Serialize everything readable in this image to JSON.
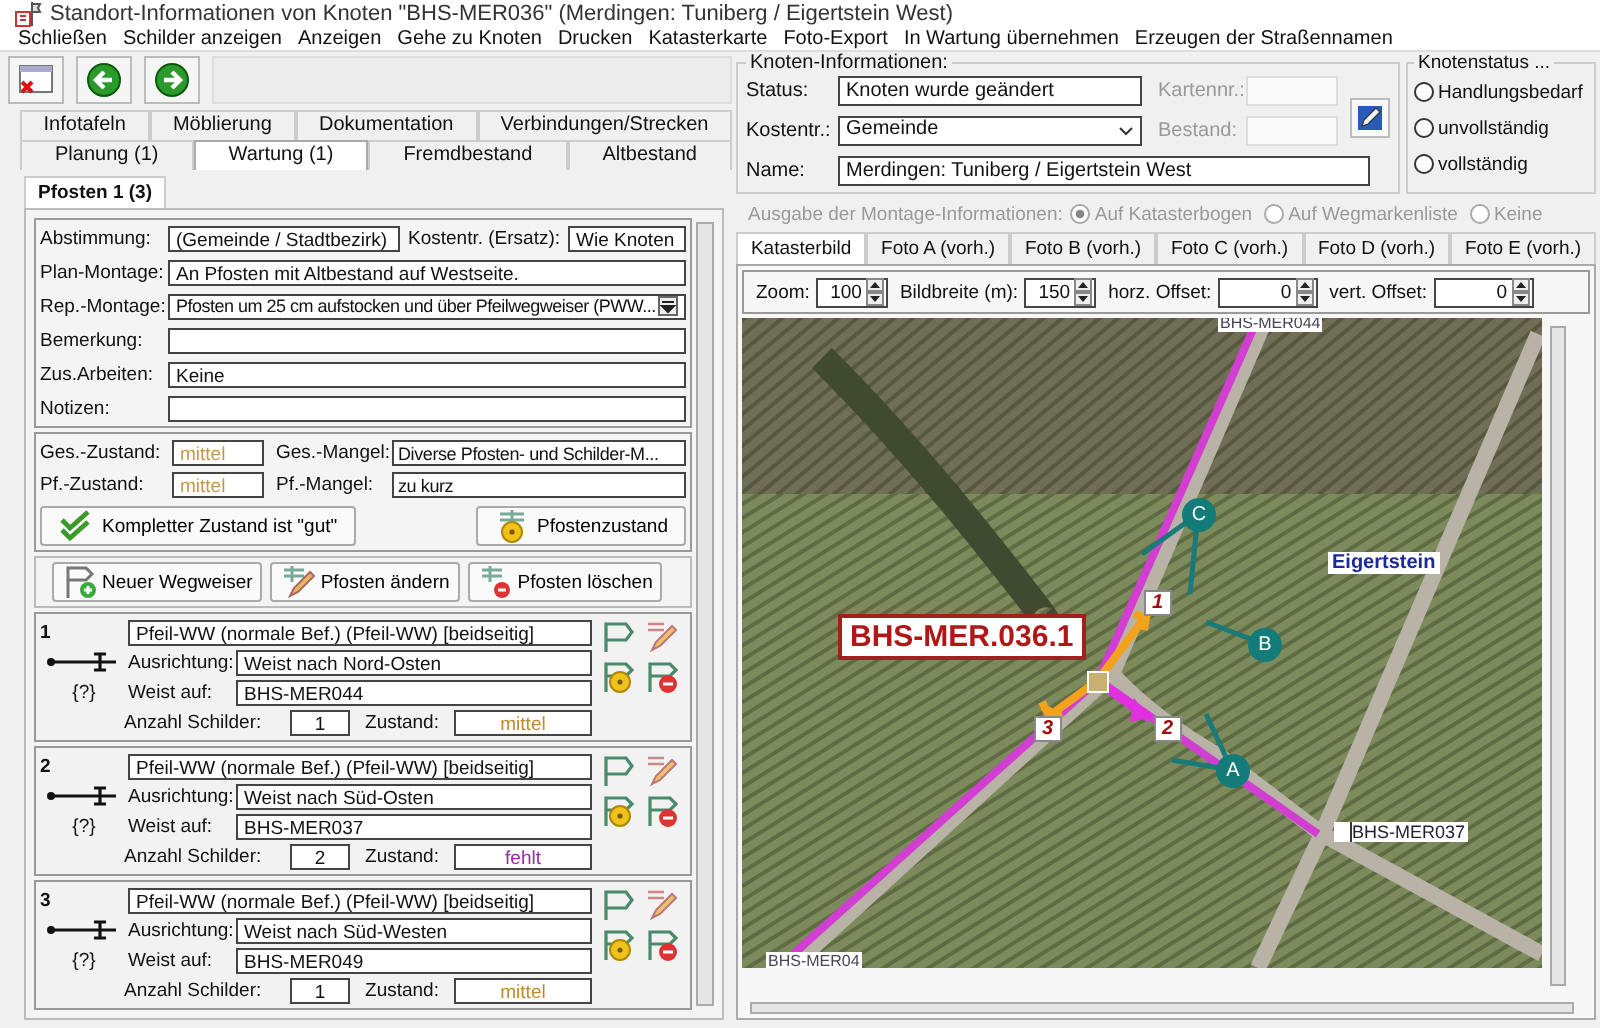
{
  "window": {
    "title": "Standort-Informationen von Knoten \"BHS-MER036\" (Merdingen: Tuniberg / Eigertstein West)"
  },
  "menu": [
    "Schließen",
    "Schilder anzeigen",
    "Anzeigen",
    "Gehe zu Knoten",
    "Drucken",
    "Katasterkarte",
    "Foto-Export",
    "In Wartung übernehmen",
    "Erzeugen der Straßennamen"
  ],
  "tab_rows": [
    [
      {
        "label": "Infotafeln",
        "selected": false
      },
      {
        "label": "Möblierung",
        "selected": false
      },
      {
        "label": "Dokumentation",
        "selected": false
      },
      {
        "label": "Verbindungen/Strecken",
        "selected": false
      }
    ],
    [
      {
        "label": "Planung (1)",
        "selected": false
      },
      {
        "label": "Wartung (1)",
        "selected": true
      },
      {
        "label": "Fremdbestand",
        "selected": false
      },
      {
        "label": "Altbestand",
        "selected": false
      }
    ]
  ],
  "subtabs": [
    {
      "label": "Pfosten 1 (3)",
      "selected": true
    }
  ],
  "post_fields": [
    {
      "kind": "pair",
      "label": "Abstimmung:",
      "value": "(Gemeinde / Stadtbezirk)",
      "label_2": "Kostentr. (Ersatz):",
      "value_2": "Wie Knoten"
    },
    {
      "kind": "text",
      "label": "Plan-Montage:",
      "value": "An Pfosten mit Altbestand auf Westseite."
    },
    {
      "kind": "dropdown",
      "label": "Rep.-Montage:",
      "value": "Pfosten um 25 cm aufstocken und über Pfeilwegweiser (PWW..."
    },
    {
      "kind": "text",
      "label": "Bemerkung:"
    },
    {
      "kind": "text",
      "label": "Zus.Arbeiten:",
      "value": "Keine"
    },
    {
      "kind": "text",
      "label": "Notizen:"
    }
  ],
  "condition_rows": [
    {
      "zustand_label": "Ges.-Zustand:",
      "zustand": "mittel",
      "color": "#c8964a",
      "mangel_label": "Ges.-Mangel:",
      "mangel": "Diverse Pfosten- und Schilder-M..."
    },
    {
      "zustand_label": "Pf.-Zustand:",
      "zustand": "mittel",
      "color": "#c8964a",
      "mangel_label": "Pf.-Mangel:",
      "mangel": "zu kurz"
    }
  ],
  "condition_buttons": [
    "Kompletter Zustand ist \"gut\"",
    "Pfostenzustand"
  ],
  "sign_actions": [
    "Neuer Wegweiser",
    "Pfosten ändern",
    "Pfosten löschen"
  ],
  "signs": [
    {
      "number": "1",
      "type": "Pfeil-WW (normale Bef.) (Pfeil-WW) [beidseitig]",
      "marker": "{?}",
      "ausrichtung_label": "Ausrichtung:",
      "ausrichtung": "Weist nach Nord-Osten",
      "weist_label": "Weist auf:",
      "weist": "BHS-MER044",
      "anzahl_label": "Anzahl Schilder:",
      "anzahl": "1",
      "zustand_label": "Zustand:",
      "zustand": "mittel",
      "color": "#c08a2c"
    },
    {
      "number": "2",
      "type": "Pfeil-WW (normale Bef.) (Pfeil-WW) [beidseitig]",
      "marker": "{?}",
      "ausrichtung_label": "Ausrichtung:",
      "ausrichtung": "Weist nach Süd-Osten",
      "weist_label": "Weist auf:",
      "weist": "BHS-MER037",
      "anzahl_label": "Anzahl Schilder:",
      "anzahl": "2",
      "zustand_label": "Zustand:",
      "zustand": "fehlt",
      "color": "#9a2aa8"
    },
    {
      "number": "3",
      "type": "Pfeil-WW (normale Bef.) (Pfeil-WW) [beidseitig]",
      "marker": "{?}",
      "ausrichtung_label": "Ausrichtung:",
      "ausrichtung": "Weist nach Süd-Westen",
      "weist_label": "Weist auf:",
      "weist": "BHS-MER049",
      "anzahl_label": "Anzahl Schilder:",
      "anzahl": "1",
      "zustand_label": "Zustand:",
      "zustand": "mittel",
      "color": "#c08a2c"
    }
  ],
  "knoten_info": {
    "title": "Knoten-Informationen:",
    "fields": [
      {
        "kind": "text",
        "label": "Status:",
        "value": "Knoten wurde geändert"
      },
      {
        "kind": "dropdown",
        "label": "Kostentr.:",
        "value": "Gemeinde"
      },
      {
        "kind": "text",
        "label": "Name:",
        "value": "Merdingen: Tuniberg / Eigertstein West"
      }
    ],
    "side_fields": [
      {
        "label": "Kartennr.:",
        "disabled": true
      },
      {
        "label": "Bestand:",
        "disabled": true
      }
    ]
  },
  "knotenstatus": {
    "title": "Knotenstatus ...",
    "options": [
      {
        "label": "Handlungsbedarf",
        "selected": false
      },
      {
        "label": "unvollständig",
        "selected": false
      },
      {
        "label": "vollständig",
        "selected": false
      }
    ]
  },
  "output": {
    "label": "Ausgabe der Montage-Informationen:",
    "disabled": true,
    "options": [
      {
        "label": "Auf Katasterbogen",
        "selected": true
      },
      {
        "label": "Auf Wegmarkenliste",
        "selected": false
      },
      {
        "label": "Keine",
        "selected": false
      }
    ]
  },
  "image_tabs": [
    {
      "label": "Katasterbild",
      "selected": true
    },
    {
      "label": "Foto A (vorh.)",
      "selected": false
    },
    {
      "label": "Foto B (vorh.)",
      "selected": false
    },
    {
      "label": "Foto C (vorh.)",
      "selected": false
    },
    {
      "label": "Foto D (vorh.)",
      "selected": false
    },
    {
      "label": "Foto E (vorh.)",
      "selected": false
    }
  ],
  "view_controls": [
    {
      "label": "Zoom:",
      "value": "100"
    },
    {
      "label": "Bildbreite (m):",
      "value": "150"
    },
    {
      "label": "horz. Offset:",
      "value": "0"
    },
    {
      "label": "vert. Offset:",
      "value": "0"
    }
  ],
  "map": {
    "post_label": "BHS-MER.036.1",
    "place": "Eigertstein",
    "nodes": [
      "BHS-MER044",
      "BHS-MER037",
      "BHS-MER04"
    ],
    "sign_numbers": [
      "1",
      "2",
      "3"
    ],
    "photo_markers": [
      "A",
      "B",
      "C"
    ]
  }
}
